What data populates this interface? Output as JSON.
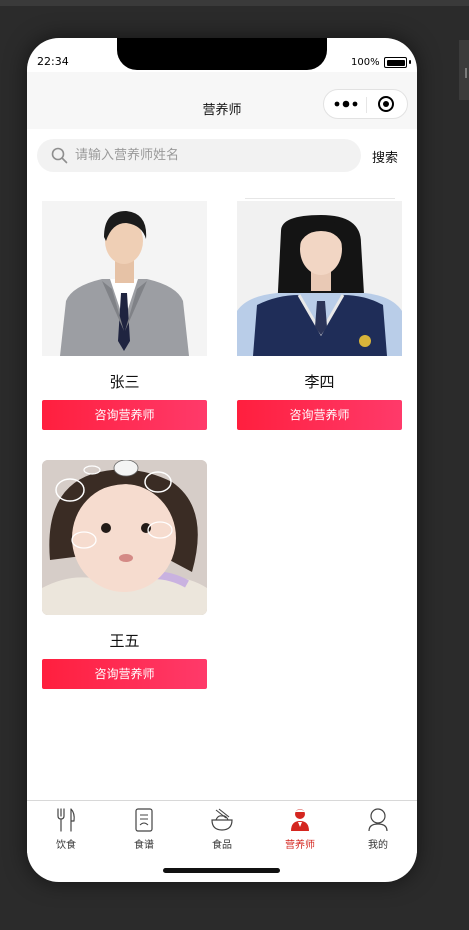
{
  "status_bar": {
    "time": "22:34",
    "battery": "100%"
  },
  "navbar": {
    "title": "营养师",
    "menu_icon": "more-dots-icon",
    "close_icon": "record-circle-icon"
  },
  "search": {
    "placeholder": "请输入营养师姓名",
    "value": "",
    "button_label": "搜索"
  },
  "nutritionists": [
    {
      "name": "张三",
      "button": "咨询营养师"
    },
    {
      "name": "李四",
      "button": "咨询营养师"
    },
    {
      "name": "王五",
      "button": "咨询营养师"
    }
  ],
  "tabbar": {
    "active_color": "#d4261f",
    "items": [
      {
        "label": "饮食",
        "icon": "fork-knife-icon"
      },
      {
        "label": "食谱",
        "icon": "recipe-book-icon"
      },
      {
        "label": "食品",
        "icon": "food-bowl-icon"
      },
      {
        "label": "营养师",
        "icon": "nutritionist-icon",
        "active": true
      },
      {
        "label": "我的",
        "icon": "profile-icon"
      }
    ]
  },
  "colors": {
    "accent_gradient_start": "#ff1f3e",
    "accent_gradient_end": "#ff3a6a"
  }
}
